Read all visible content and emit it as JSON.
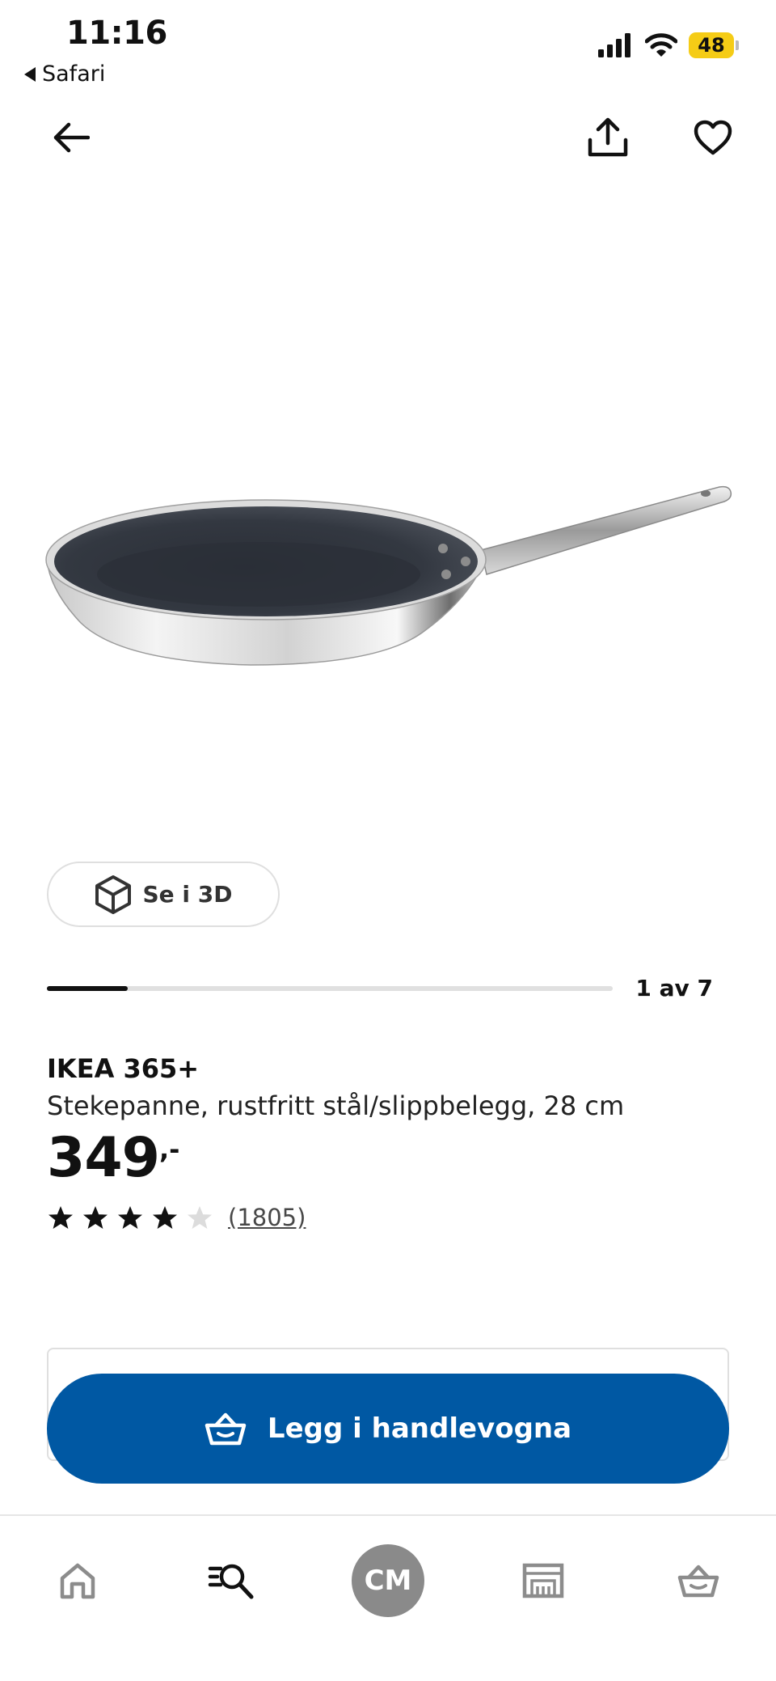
{
  "status_bar": {
    "time": "11:16",
    "back_app": "Safari",
    "battery": "48",
    "battery_color": "#f5cc16"
  },
  "nav": {
    "icons": [
      "arrow-left-icon",
      "share-icon",
      "heart-icon"
    ]
  },
  "gallery": {
    "view_3d_label": "Se i 3D",
    "counter": "1 av 7",
    "current_index": 1,
    "total": 7
  },
  "product": {
    "brand": "IKEA 365+",
    "description": "Stekepanne, rustfritt stål/slippbelegg, 28 cm",
    "price": "349",
    "price_suffix": ",-",
    "rating": 4,
    "rating_max": 5,
    "review_count": "(1805)"
  },
  "cart": {
    "add_label": "Legg i handlevogna",
    "accent_color": "#0058a3"
  },
  "tab_bar": {
    "profile_initials": "CM",
    "icons": [
      "home-icon",
      "search-list-icon",
      "avatar",
      "store-icon",
      "basket-icon"
    ]
  }
}
